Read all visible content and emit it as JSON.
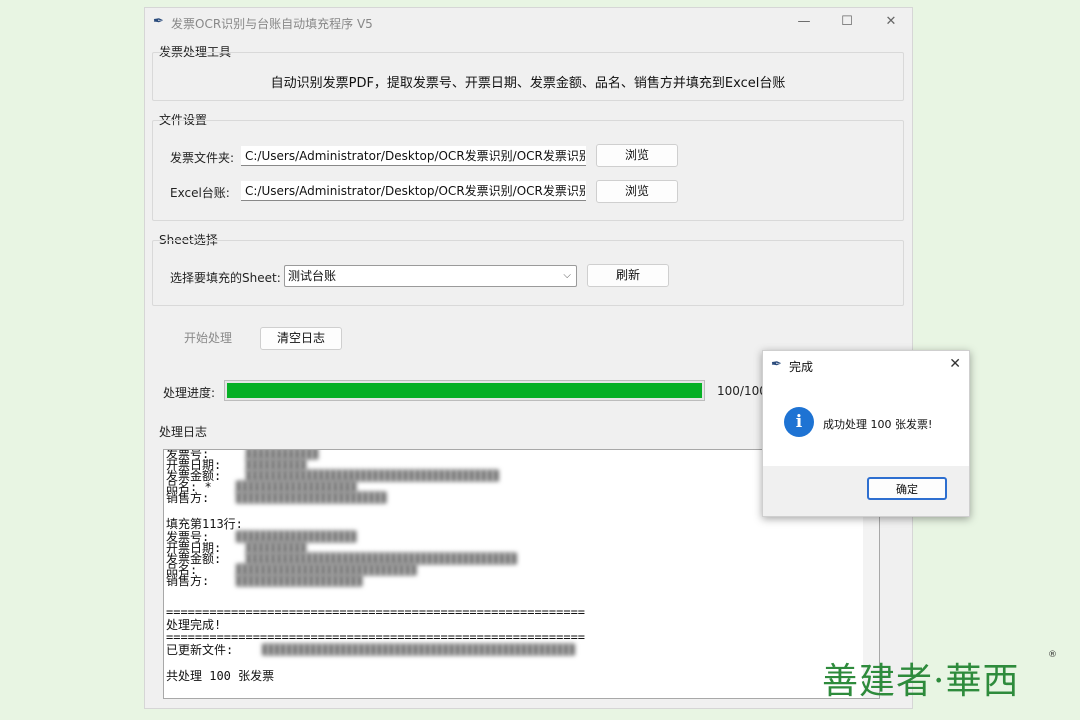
{
  "window": {
    "title": "发票OCR识别与台账自动填充程序 V5",
    "controls": [
      "—",
      "☐",
      "✕"
    ]
  },
  "tool_group": {
    "label": "发票处理工具",
    "description": "自动识别发票PDF，提取发票号、开票日期、发票金额、品名、销售方并填充到Excel台账"
  },
  "file_group": {
    "label": "文件设置",
    "invoice_folder_label": "发票文件夹:",
    "invoice_folder_value": "C:/Users/Administrator/Desktop/OCR发票识别/OCR发票识别/",
    "excel_label": "Excel台账:",
    "excel_value": "C:/Users/Administrator/Desktop/OCR发票识别/OCR发票识别/",
    "browse_label": "浏览"
  },
  "sheet_group": {
    "label": "Sheet选择",
    "select_label": "选择要填充的Sheet:",
    "selected_value": "测试台账",
    "refresh_label": "刷新"
  },
  "actions": {
    "start_label": "开始处理",
    "clear_label": "清空日志"
  },
  "progress": {
    "label": "处理进度:",
    "value": 1.0,
    "text": "100/100"
  },
  "log": {
    "label": "处理日志",
    "lines": [
      "  发票号:",
      "  开票日期:",
      "  发票金额:",
      "  品名: *",
      "  销售方:",
      "",
      "填充第113行:",
      "  发票号:",
      "  开票日期:",
      "  发票金额:",
      "  品名:",
      "  销售方:",
      "",
      "==========================================================",
      "处理完成!",
      "==========================================================",
      "已更新文件:",
      "",
      "共处理 100 张发票"
    ]
  },
  "dialog": {
    "title": "完成",
    "message": "成功处理 100 张发票!",
    "ok_label": "确定"
  },
  "watermark": {
    "text": "善建者·華西",
    "registered": "®"
  },
  "colors": {
    "page_bg": "#e8f5e3",
    "window_bg": "#f0f0f0",
    "progress_fill": "#06b025",
    "info_icon": "#1e73d3",
    "watermark": "#2e8b3c"
  }
}
